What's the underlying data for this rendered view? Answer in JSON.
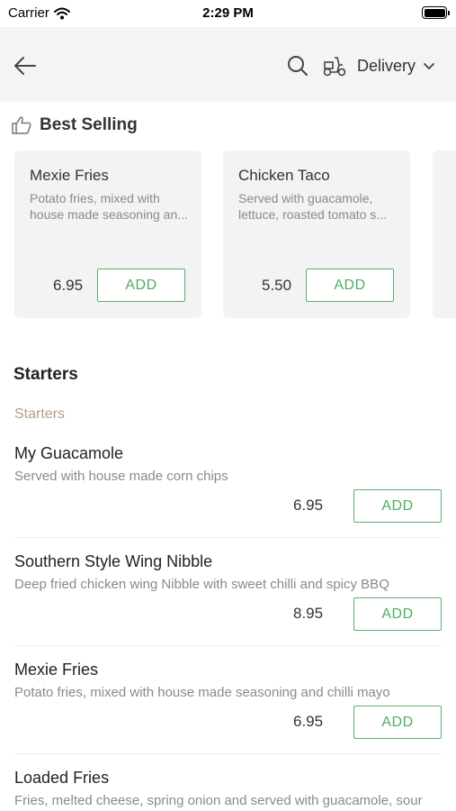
{
  "status_bar": {
    "carrier": "Carrier",
    "time": "2:29 PM"
  },
  "header": {
    "delivery_label": "Delivery"
  },
  "best_selling": {
    "title": "Best Selling",
    "items": [
      {
        "name": "Mexie Fries",
        "description": "Potato fries, mixed with house made seasoning an...",
        "price": "6.95",
        "add_label": "ADD"
      },
      {
        "name": "Chicken Taco",
        "description": "Served with guacamole, lettuce, roasted tomato s...",
        "price": "5.50",
        "add_label": "ADD"
      }
    ]
  },
  "starters": {
    "heading": "Starters",
    "subheading": "Starters",
    "items": [
      {
        "name": "My Guacamole",
        "description": "Served with house made corn chips",
        "price": "6.95",
        "add_label": "ADD"
      },
      {
        "name": "Southern Style Wing Nibble",
        "description": "Deep fried chicken wing Nibble with sweet chilli and spicy BBQ",
        "price": "8.95",
        "add_label": "ADD"
      },
      {
        "name": "Mexie Fries",
        "description": "Potato fries, mixed with house made seasoning and chilli mayo",
        "price": "6.95",
        "add_label": "ADD"
      },
      {
        "name": "Loaded Fries",
        "description": "Fries, melted cheese, spring onion and served with guacamole, sour"
      }
    ]
  },
  "colors": {
    "accent_green": "#4caf60",
    "subheading_tan": "#b0a184",
    "nav_background": "#f4f4f4"
  }
}
